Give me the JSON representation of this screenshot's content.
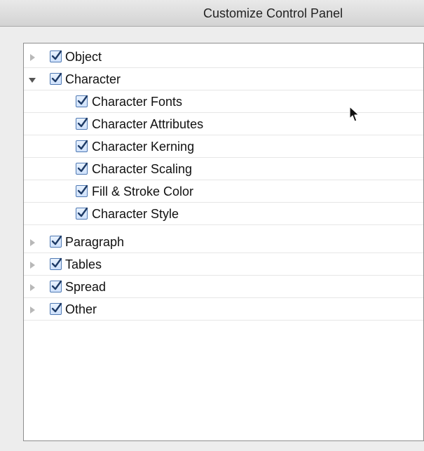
{
  "window": {
    "title": "Customize Control Panel"
  },
  "tree": {
    "groups": [
      {
        "label": "Object",
        "expanded": false,
        "checked": true
      },
      {
        "label": "Character",
        "expanded": true,
        "checked": true,
        "children": [
          {
            "label": "Character Fonts",
            "checked": true
          },
          {
            "label": "Character Attributes",
            "checked": true
          },
          {
            "label": "Character Kerning",
            "checked": true
          },
          {
            "label": "Character Scaling",
            "checked": true
          },
          {
            "label": "Fill & Stroke Color",
            "checked": true
          },
          {
            "label": "Character Style",
            "checked": true
          }
        ]
      },
      {
        "label": "Paragraph",
        "expanded": false,
        "checked": true
      },
      {
        "label": "Tables",
        "expanded": false,
        "checked": true
      },
      {
        "label": "Spread",
        "expanded": false,
        "checked": true
      },
      {
        "label": "Other",
        "expanded": false,
        "checked": true
      }
    ]
  },
  "icons": {
    "collapsed": "triangle-right-icon",
    "expanded": "triangle-down-icon",
    "checkbox": "checkmark-icon",
    "cursor": "mouse-pointer-icon"
  },
  "colors": {
    "checkbox_border": "#4f79b3",
    "checkmark": "#1e3b66",
    "disclosure_collapsed": "#b8b8b8",
    "disclosure_expanded": "#555555"
  }
}
